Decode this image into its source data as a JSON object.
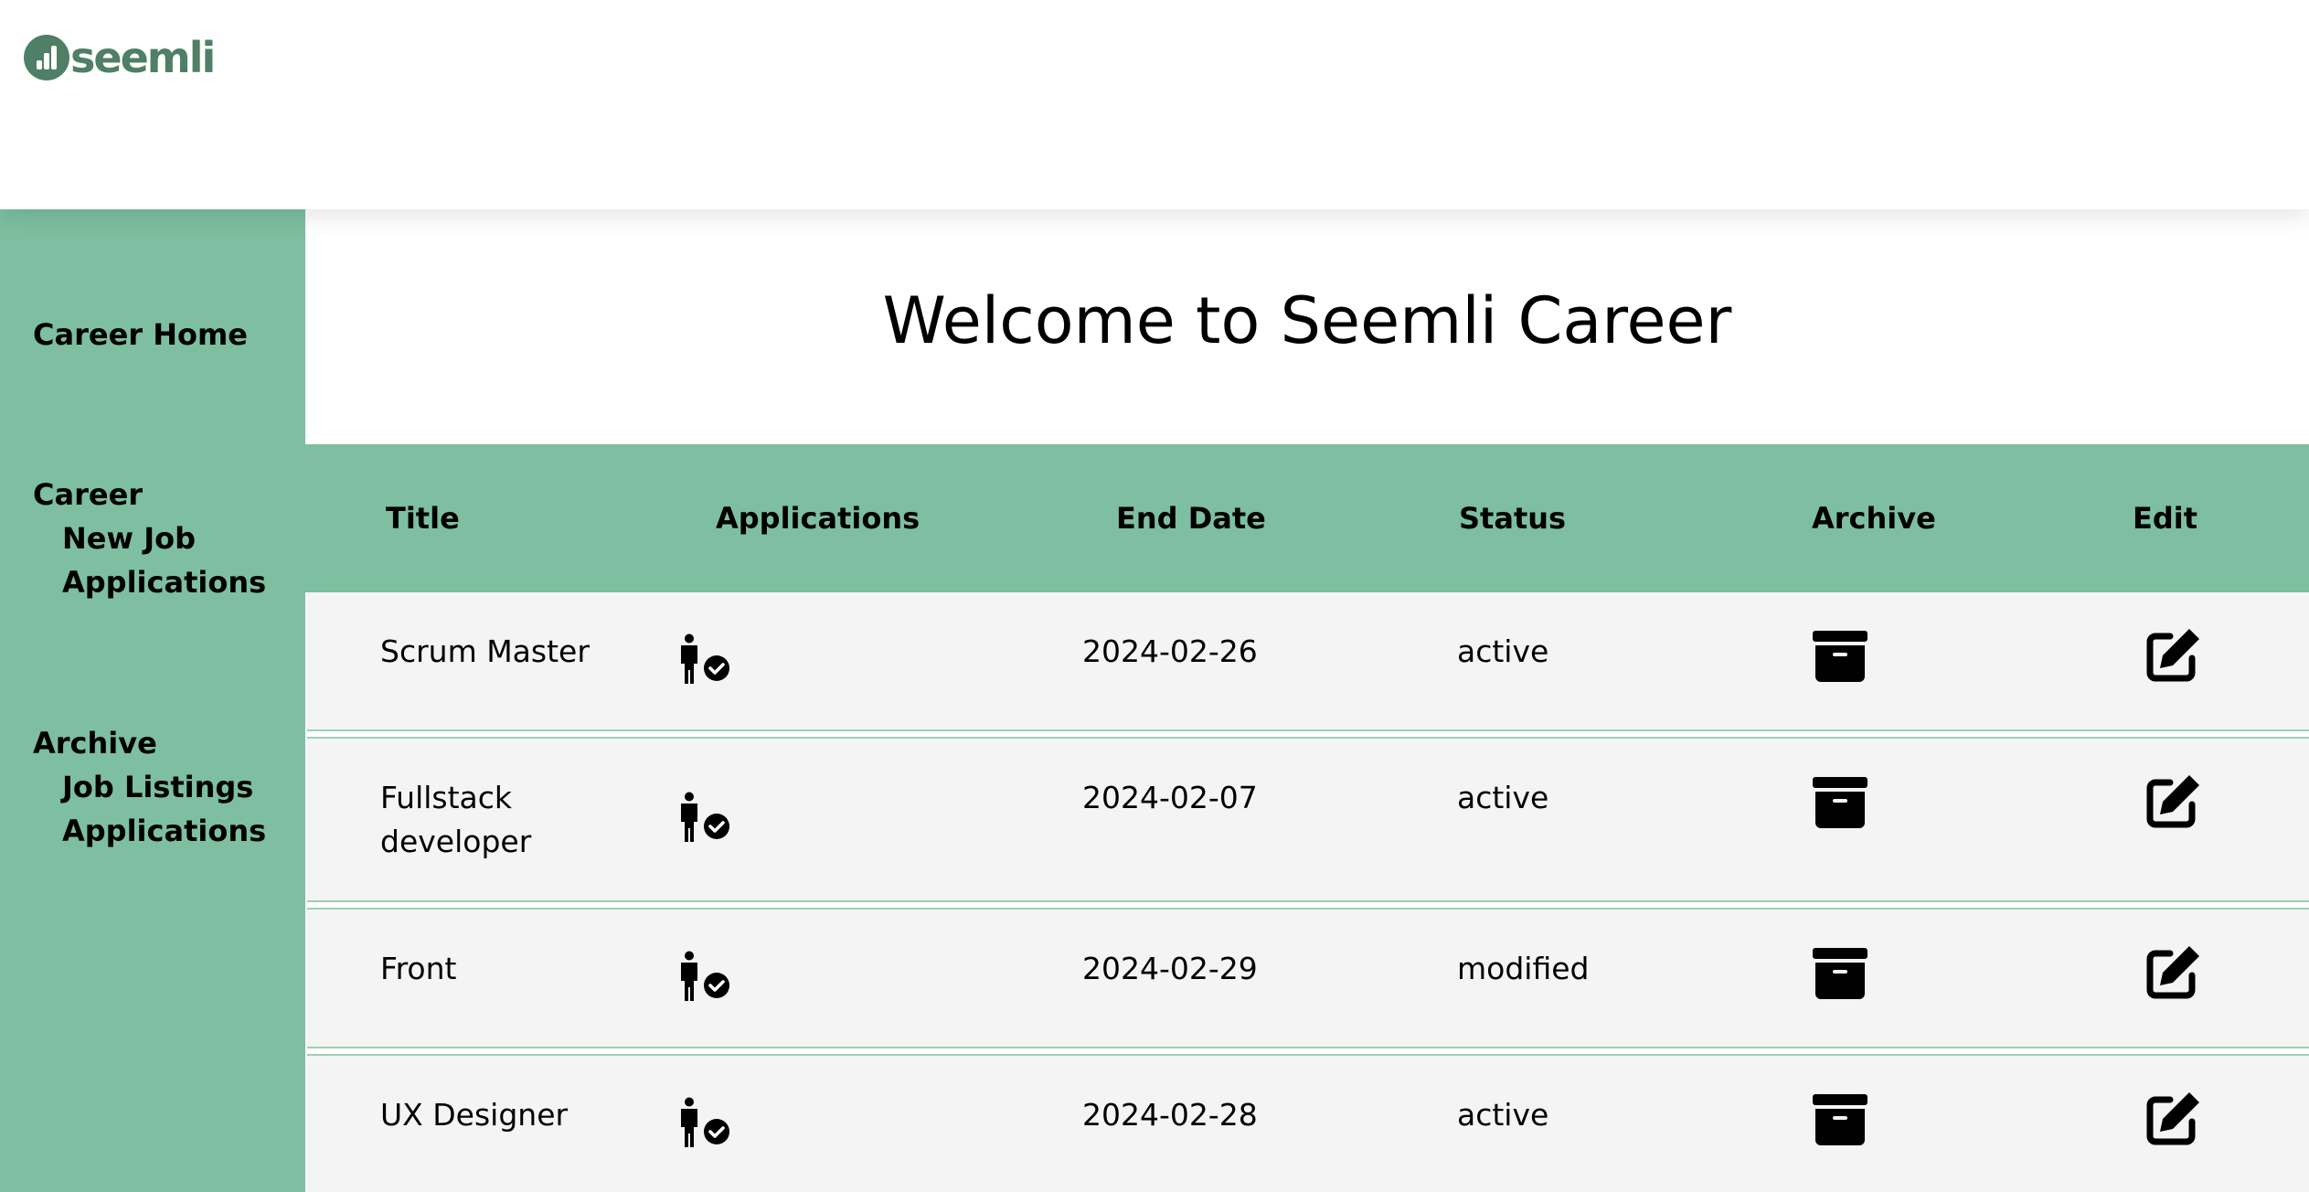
{
  "brand": {
    "logo_text": "seemli",
    "color": "#4f7f66"
  },
  "colors": {
    "accent": "#7dbfa0",
    "row_bg": "#f4f4f4"
  },
  "sidebar": {
    "career_home": "Career Home",
    "career": {
      "heading": "Career",
      "items": [
        "New Job",
        "Applications"
      ]
    },
    "archive": {
      "heading": "Archive",
      "items": [
        "Job Listings",
        "Applications"
      ]
    }
  },
  "main": {
    "title": "Welcome to Seemli Career",
    "table": {
      "columns": [
        "Title",
        "Applications",
        "End Date",
        "Status",
        "Archive",
        "Edit"
      ],
      "rows": [
        {
          "title_lines": [
            "Scrum Master"
          ],
          "end_date": "2024-02-26",
          "status": "active"
        },
        {
          "title_lines": [
            "Fullstack",
            "developer"
          ],
          "end_date": "2024-02-07",
          "status": "active"
        },
        {
          "title_lines": [
            "Front"
          ],
          "end_date": "2024-02-29",
          "status": "modified"
        },
        {
          "title_lines": [
            "UX Designer"
          ],
          "end_date": "2024-02-28",
          "status": "active"
        }
      ],
      "row_icons": {
        "applications": "person-check-icon",
        "archive": "archive-box-icon",
        "edit": "edit-pen-icon"
      }
    }
  }
}
